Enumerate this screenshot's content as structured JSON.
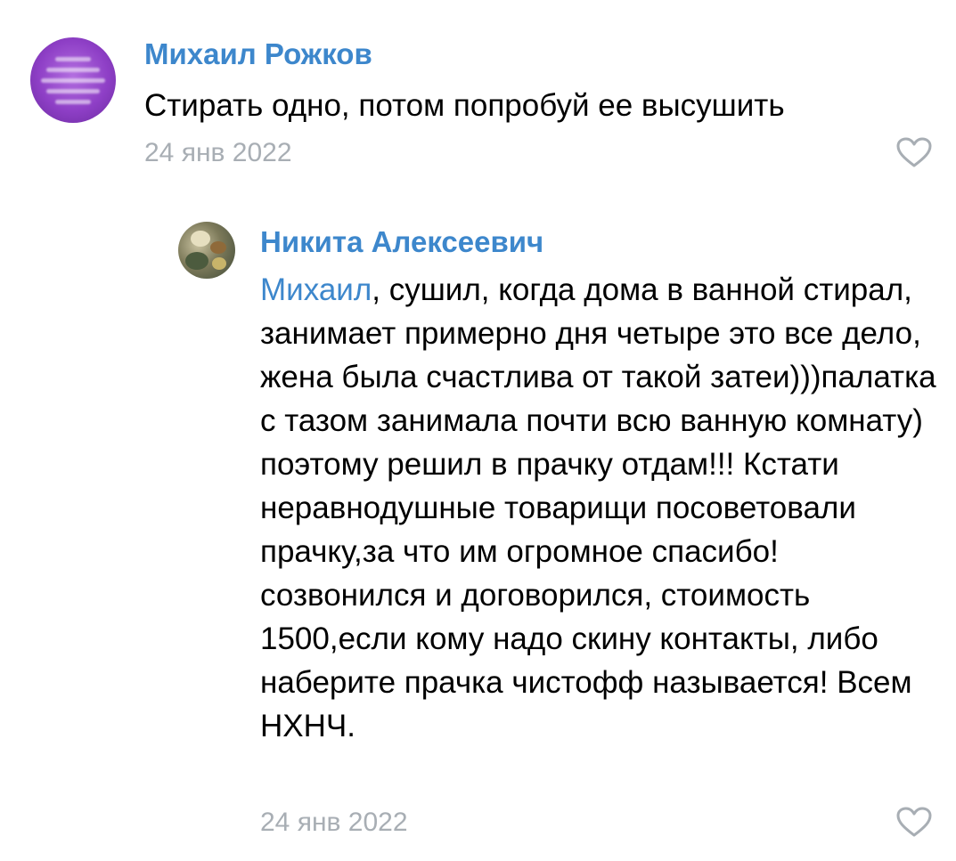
{
  "comments": [
    {
      "author": "Михаил Рожков",
      "text": "Стирать одно, потом попробуй ее высушить",
      "date": "24 янв 2022",
      "like_icon": "heart-outline-icon"
    },
    {
      "author": "Никита Алексеевич",
      "mention": "Михаил",
      "text": ", сушил, когда дома в ванной стирал, занимает примерно дня четыре это все дело, жена была счастлива от такой затеи)))палатка с тазом занимала почти всю ванную комнату) поэтому решил в прачку отдам!!! Кстати неравнодушные товарищи посоветовали прачку,за что им огромное спасибо! созвонился и договорился, стоимость 1500,если кому надо скину контакты, либо наберите прачка чистофф называется! Всем НХНЧ.",
      "date": "24 янв 2022",
      "like_icon": "heart-outline-icon"
    }
  ],
  "colors": {
    "link": "#3d87cc",
    "meta": "#a8aeb4",
    "text": "#000000"
  }
}
